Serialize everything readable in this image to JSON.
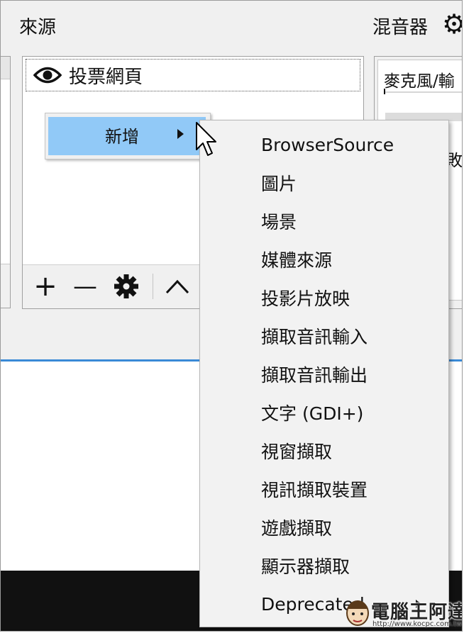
{
  "sources": {
    "title": "來源",
    "items": [
      {
        "label": "投票網頁"
      }
    ],
    "toolbar": {
      "add": "+",
      "remove": "—",
      "up": "^"
    }
  },
  "mixer": {
    "title": "混音器",
    "channel_label": "麥克風/輸",
    "cut_text": "敗"
  },
  "context_menu": {
    "parent_label": "新增",
    "items": [
      "BrowserSource",
      "圖片",
      "場景",
      "媒體來源",
      "投影片放映",
      "擷取音訊輸入",
      "擷取音訊輸出",
      "文字 (GDI+)",
      "視窗擷取",
      "視訊擷取裝置",
      "遊戲擷取",
      "顯示器擷取",
      "Deprecated"
    ]
  },
  "watermark": {
    "text": "電腦王阿達",
    "url": "http://www.kocpc.com.tw"
  },
  "colors": {
    "highlight": "#91c9f7",
    "accent_line": "#3a8ad6",
    "menu_bg": "#f2f2f2",
    "window_bg": "#f0f0f0"
  }
}
